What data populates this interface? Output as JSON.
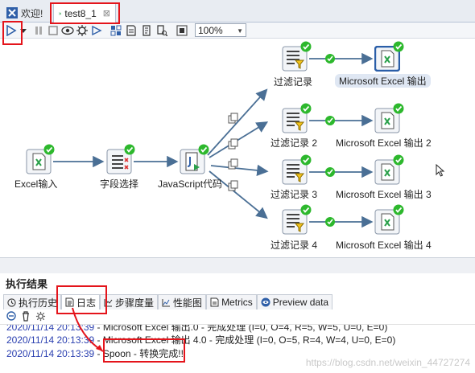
{
  "tabs": [
    {
      "label": "欢迎!",
      "icon": "welcome-icon"
    },
    {
      "label": "test8_1",
      "icon": "transformation-icon",
      "close": "⊠"
    }
  ],
  "toolbar": {
    "zoom": "100%",
    "buttons": [
      "run-icon",
      "run-dropdown-icon",
      "pause-icon",
      "stop-icon",
      "preview-icon",
      "debug-icon",
      "replay-icon",
      "verify-icon",
      "impact-icon",
      "sql-icon",
      "explore-db-icon",
      "align-icon"
    ]
  },
  "steps": {
    "excel_input": "Excel输入",
    "select_fields": "字段选择",
    "javascript": "JavaScript代码",
    "filter1": "过滤记录",
    "filter2": "过滤记录 2",
    "filter3": "过滤记录 3",
    "filter4": "过滤记录 4",
    "output1": "Microsoft Excel 输出",
    "output2": "Microsoft Excel 输出 2",
    "output3": "Microsoft Excel 输出 3",
    "output4": "Microsoft Excel 输出 4"
  },
  "results": {
    "title": "执行结果",
    "tabs": [
      "执行历史",
      "日志",
      "步骤度量",
      "性能图",
      "Metrics",
      "Preview data"
    ],
    "active_tab": "日志",
    "log_lines": [
      {
        "ts": "2020/11/14 20:13:39",
        "msg": " - Microsoft Excel 输出.0 - 完成处理 (I=0, O=4, R=5, W=5, U=0, E=0)"
      },
      {
        "ts": "2020/11/14 20:13:39",
        "msg": " - Microsoft Excel 输出 4.0 - 完成处理 (I=0, O=5, R=4, W=4, U=0, E=0)"
      },
      {
        "ts": "2020/11/14 20:13:39",
        "msg": " - Spoon - 转换完成!!"
      }
    ]
  },
  "watermark": "https://blog.csdn.net/weixin_44727274",
  "colors": {
    "accent_red": "#e4141b",
    "ok_green": "#2db82d",
    "hop_blue": "#4a6f95",
    "timestamp_blue": "#2a3fb0"
  }
}
